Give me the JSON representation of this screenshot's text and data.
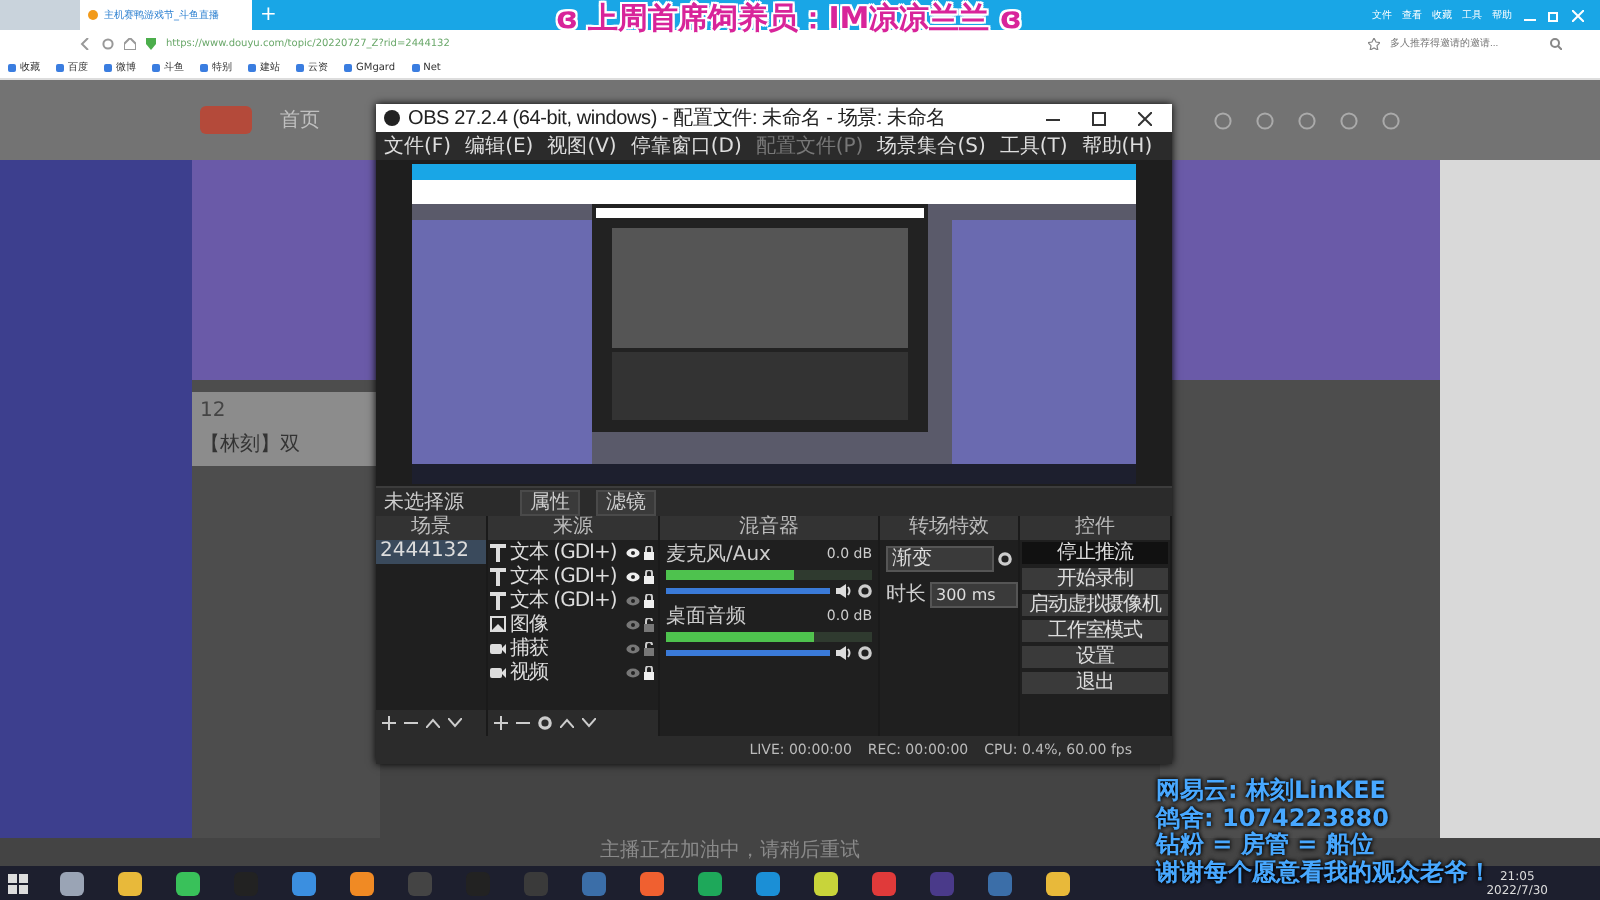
{
  "overlay": {
    "title": "ɞ 上周首席饲养员：IM凉凉兰兰 ɞ",
    "lines": [
      "网易云: 林刻LinKEE",
      "鸽舍: 1074223880",
      "钻粉 = 房管 = 船位",
      "谢谢每个愿意看我的观众老爷！"
    ]
  },
  "browser": {
    "tabs": [
      {
        "title": "主机赛鸭游戏节_斗鱼直播",
        "selected": true
      }
    ],
    "new_tab": "+",
    "menu": [
      "文件",
      "查看",
      "收藏",
      "工具",
      "帮助"
    ],
    "url": "https://www.douyu.com/topic/20220727_Z?rid=2444132",
    "search": {
      "placeholder": "多人推荐得邀请的邀请..."
    },
    "bookmarks": [
      "收藏",
      "百度",
      "微博",
      "斗鱼",
      "特别",
      "建站",
      "云资",
      "GMgard",
      "Net"
    ]
  },
  "site": {
    "nav": [
      "首页"
    ],
    "count": "12",
    "streamer": "【林刻】双",
    "notice": "主播正在加油中，请稍后重试"
  },
  "obs": {
    "title": "OBS 27.2.4 (64-bit, windows) - 配置文件: 未命名 - 场景: 未命名",
    "menu": [
      {
        "label": "文件(F)",
        "disabled": false
      },
      {
        "label": "编辑(E)",
        "disabled": false
      },
      {
        "label": "视图(V)",
        "disabled": false
      },
      {
        "label": "停靠窗口(D)",
        "disabled": false
      },
      {
        "label": "配置文件(P)",
        "disabled": true
      },
      {
        "label": "场景集合(S)",
        "disabled": false
      },
      {
        "label": "工具(T)",
        "disabled": false
      },
      {
        "label": "帮助(H)",
        "disabled": false
      }
    ],
    "source_bar": {
      "label": "未选择源",
      "buttons": [
        "属性",
        "滤镜"
      ]
    },
    "docks": {
      "scenes": "场景",
      "sources": "来源",
      "mixer": "混音器",
      "transitions": "转场特效",
      "controls": "控件"
    },
    "scenes": [
      {
        "name": "2444132",
        "selected": true
      }
    ],
    "sources": [
      {
        "kind": "text",
        "label": "文本 (GDI+)",
        "visible": true,
        "locked": true
      },
      {
        "kind": "text",
        "label": "文本 (GDI+)",
        "visible": true,
        "locked": true
      },
      {
        "kind": "text",
        "label": "文本 (GDI+)",
        "visible": false,
        "locked": true
      },
      {
        "kind": "image",
        "label": "图像",
        "visible": false,
        "locked": false
      },
      {
        "kind": "camera",
        "label": "捕获",
        "visible": false,
        "locked": false
      },
      {
        "kind": "camera",
        "label": "视频",
        "visible": false,
        "locked": true
      }
    ],
    "mixer": [
      {
        "name": "麦克风/Aux",
        "reading": "0.0 dB",
        "meter": {
          "level": 0.62
        },
        "volume": {
          "level": 1
        }
      },
      {
        "name": "桌面音频",
        "reading": "0.0 dB",
        "meter": {
          "level": 0.72
        },
        "volume": {
          "level": 1
        }
      }
    ],
    "transition": {
      "value": "渐变",
      "duration_label": "时长",
      "duration": "300 ms"
    },
    "controls": [
      "停止推流",
      "开始录制",
      "启动虚拟摄像机",
      "工作室模式",
      "设置",
      "退出"
    ],
    "status": {
      "live": "LIVE: 00:00:00",
      "rec": "REC: 00:00:00",
      "cpu": "CPU: 0.4%, 60.00 fps"
    }
  },
  "taskbar": {
    "time": "21:05",
    "date": "2022/7/30"
  }
}
